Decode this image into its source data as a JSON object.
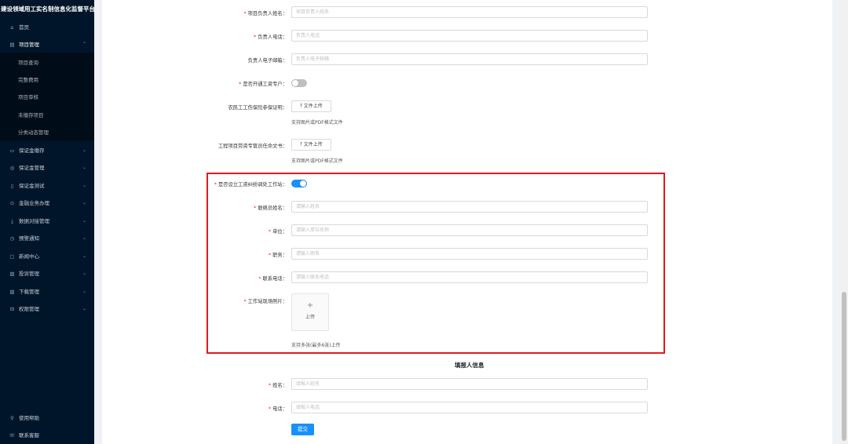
{
  "sidebar": {
    "title": "建设领域用工实名制信息化监督平台",
    "items": [
      {
        "label": "首页",
        "icon": "home-icon",
        "glyph": "⌂",
        "chevron": false
      },
      {
        "label": "项目管理",
        "icon": "project-icon",
        "glyph": "▤",
        "chevron": true,
        "open": true
      },
      {
        "label": "保证金缴存",
        "icon": "deposit-icon",
        "glyph": "▭",
        "chevron": true
      },
      {
        "label": "保证金管理",
        "icon": "guarantee-icon",
        "glyph": "◎",
        "chevron": true
      },
      {
        "label": "保证金测试",
        "icon": "test-icon",
        "glyph": "▯",
        "chevron": true
      },
      {
        "label": "金融业务办理",
        "icon": "finance-icon",
        "glyph": "⊙",
        "chevron": true
      },
      {
        "label": "数据对接管理",
        "icon": "data-icon",
        "glyph": "⤓",
        "chevron": true
      },
      {
        "label": "预警通知",
        "icon": "alert-icon",
        "glyph": "◷",
        "chevron": true
      },
      {
        "label": "新闻中心",
        "icon": "news-icon",
        "glyph": "▢",
        "chevron": true
      },
      {
        "label": "投诉管理",
        "icon": "complaint-icon",
        "glyph": "▨",
        "chevron": true
      },
      {
        "label": "下载管理",
        "icon": "download-icon",
        "glyph": "▧",
        "chevron": true
      },
      {
        "label": "权限管理",
        "icon": "permission-icon",
        "glyph": "⊟",
        "chevron": true
      }
    ],
    "sub_items": [
      "项目查询",
      "完整费用",
      "项目审核",
      "未缴存项目",
      "分类动态管理"
    ],
    "footer": [
      {
        "label": "使用帮助",
        "icon": "help-icon",
        "glyph": "⚲"
      },
      {
        "label": "联系客服",
        "icon": "service-icon",
        "glyph": "☏"
      }
    ],
    "chevron_glyph": "⌄",
    "chevron_up_glyph": "⌃"
  },
  "form": {
    "manager_name": {
      "label": "项目负责人姓名：",
      "placeholder": "项目负责人姓名",
      "required": true
    },
    "manager_phone": {
      "label": "负责人电话：",
      "placeholder": "负责人电话",
      "required": true
    },
    "manager_email": {
      "label": "负责人电子邮箱：",
      "placeholder": "负责人电子邮箱",
      "required": false
    },
    "wage_account": {
      "label": "是否开通工资专户：",
      "required": true,
      "on": false
    },
    "injury_insurance": {
      "label": "农民工工伤保险参保证明：",
      "button": "文件上传",
      "hint": "支持图片或PDF格式文件"
    },
    "labor_contract": {
      "label": "工程项目劳资专管员任命文书：",
      "button": "文件上传",
      "hint": "支持图片或PDF格式文件"
    },
    "mediation_station": {
      "label": "是否设立工资纠纷调处工作站：",
      "required": true,
      "on": true
    },
    "contact_name": {
      "label": "联络员姓名：",
      "placeholder": "请输入姓名",
      "required": true
    },
    "unit": {
      "label": "单位：",
      "placeholder": "请输入单位名称",
      "required": true
    },
    "position": {
      "label": "职务：",
      "placeholder": "请输入职务",
      "required": true
    },
    "contact_phone": {
      "label": "联系电话：",
      "placeholder": "请输入联系电话",
      "required": true
    },
    "station_photo": {
      "label": "工作站现场照片：",
      "plus": "+",
      "upload_text": "上传",
      "hint": "支持多张(最多6张)上传",
      "required": true
    },
    "reporter_section_title": "填报人信息",
    "reporter_name": {
      "label": "姓名：",
      "placeholder": "填报人姓名",
      "required": true
    },
    "reporter_phone": {
      "label": "电话：",
      "placeholder": "填报人电话",
      "required": true
    },
    "submit_label": "提交",
    "required_mark": "*",
    "upload_icon": "⤒"
  },
  "colors": {
    "sidebar_bg": "#001529",
    "accent": "#1890ff",
    "required": "#f5222d",
    "highlight_border": "#e0191e"
  }
}
